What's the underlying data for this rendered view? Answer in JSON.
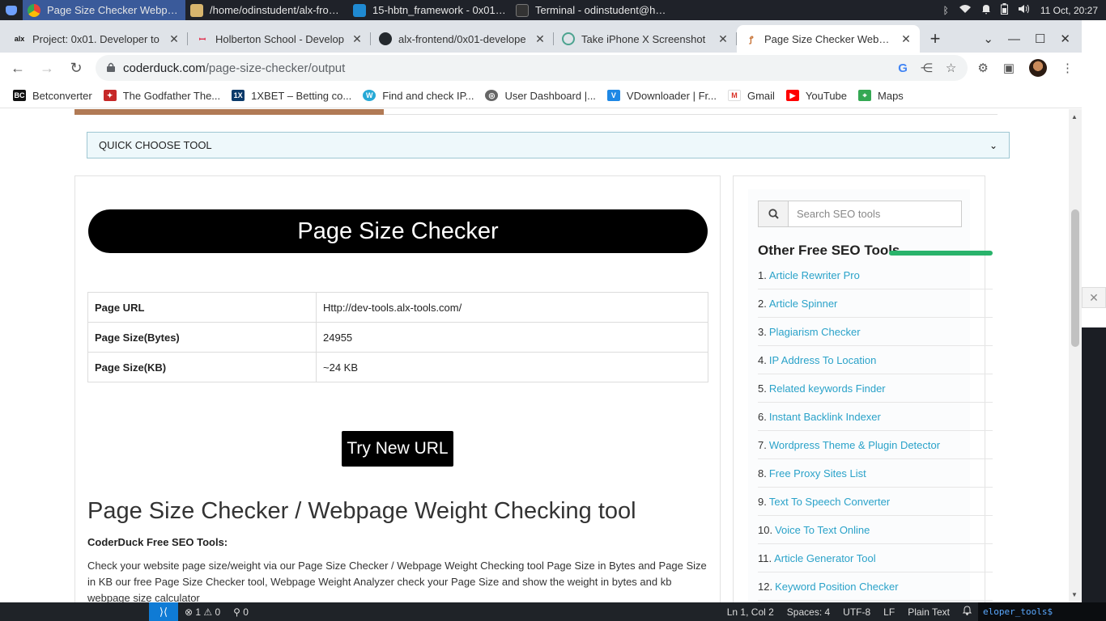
{
  "taskbar": {
    "windows": [
      {
        "title": "Page Size Checker Webpag...",
        "active": true
      },
      {
        "title": "/home/odinstudent/alx-front..."
      },
      {
        "title": "15-hbtn_framework - 0x01-d..."
      },
      {
        "title": "Terminal - odinstudent@hen..."
      }
    ],
    "clock": "11 Oct, 20:27"
  },
  "browser": {
    "tabs": [
      {
        "favicon": "alx",
        "title": "Project: 0x01. Developer to"
      },
      {
        "favicon": "holberton",
        "title": "Holberton School - Develop"
      },
      {
        "favicon": "github",
        "title": "alx-frontend/0x01-develope"
      },
      {
        "favicon": "openai",
        "title": "Take iPhone X Screenshot"
      },
      {
        "favicon": "tool",
        "title": "Page Size Checker Webpag",
        "active": true
      }
    ],
    "url_host": "coderduck.com",
    "url_path": "/page-size-checker/output",
    "bookmarks": [
      {
        "icon": "BC",
        "label": "Betconverter"
      },
      {
        "icon": "gamepad",
        "label": "The Godfather The..."
      },
      {
        "icon": "1X",
        "label": "1XBET – Betting co..."
      },
      {
        "icon": "W",
        "label": "Find and check IP..."
      },
      {
        "icon": "globe",
        "label": "User Dashboard |..."
      },
      {
        "icon": "V",
        "label": "VDownloader | Fr..."
      },
      {
        "icon": "M",
        "label": "Gmail"
      },
      {
        "icon": "play",
        "label": "YouTube"
      },
      {
        "icon": "pin",
        "label": "Maps"
      }
    ]
  },
  "page": {
    "quick_choose": "QUICK CHOOSE TOOL",
    "title": "Page Size Checker",
    "results": [
      {
        "key": "Page URL",
        "value": "Http://dev-tools.alx-tools.com/"
      },
      {
        "key": "Page Size(Bytes)",
        "value": "24955"
      },
      {
        "key": "Page Size(KB)",
        "value": "~24 KB"
      }
    ],
    "try_button": "Try New URL",
    "article_heading": "Page Size Checker / Webpage Weight Checking tool",
    "article_sub": "CoderDuck Free SEO Tools:",
    "article_text": "Check your website page size/weight via our Page Size Checker / Webpage Weight Checking tool Page Size in Bytes and Page Size in KB our free Page Size Checker tool, Webpage Weight Analyzer check your Page Size and show the weight in bytes and kb webpage size calculator"
  },
  "sidebar": {
    "search_placeholder": "Search SEO tools",
    "title": "Other Free SEO Tools",
    "accent_color": "#29b36b",
    "tools": [
      {
        "num": "1.",
        "label": "Article Rewriter Pro"
      },
      {
        "num": "2.",
        "label": "Article Spinner"
      },
      {
        "num": "3.",
        "label": "Plagiarism Checker"
      },
      {
        "num": "4.",
        "label": "IP Address To Location"
      },
      {
        "num": "5.",
        "label": "Related keywords Finder"
      },
      {
        "num": "6.",
        "label": "Instant Backlink Indexer"
      },
      {
        "num": "7.",
        "label": "Wordpress Theme & Plugin Detector"
      },
      {
        "num": "8.",
        "label": "Free Proxy Sites List"
      },
      {
        "num": "9.",
        "label": "Text To Speech Converter"
      },
      {
        "num": "10.",
        "label": "Voice To Text Online"
      },
      {
        "num": "11.",
        "label": "Article Generator Tool"
      },
      {
        "num": "12.",
        "label": "Keyword Position Checker"
      }
    ]
  },
  "statusbar": {
    "problems": "⊗ 1 ⚠ 0",
    "ports": "⚲ 0",
    "cursor": "Ln 1, Col 2",
    "spaces": "Spaces: 4",
    "encoding": "UTF-8",
    "eol": "LF",
    "language": "Plain Text",
    "terminal_text": "eloper_tools$"
  }
}
